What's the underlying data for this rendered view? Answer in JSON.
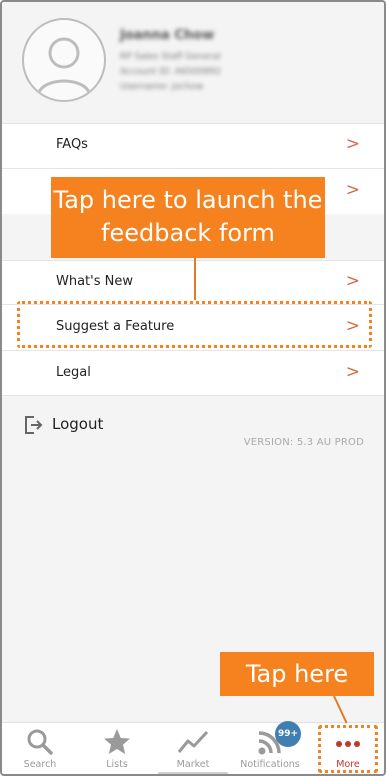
{
  "profile": {
    "name": "Joanna Chow",
    "line1": "RP Sales Staff General",
    "line2": "Account ID: A6500892",
    "line3": "Username: jochow"
  },
  "menu": {
    "faqs": "FAQs",
    "whats_new": "What's New",
    "suggest": "Suggest a Feature",
    "legal": "Legal",
    "chevron": ">"
  },
  "logout": {
    "label": "Logout"
  },
  "version": "VERSION: 5.3 AU PROD",
  "callouts": {
    "feedback": "Tap here to launch the feedback form",
    "tap_here": "Tap here"
  },
  "nav": {
    "search": "Search",
    "lists": "Lists",
    "market": "Market",
    "notifications": "Notifications",
    "notifications_badge": "99+",
    "more": "More",
    "active": "More"
  },
  "colors": {
    "accent_orange": "#f5821f",
    "chevron": "#d46a4a",
    "active_nav": "#c0392b",
    "badge": "#3f7fb2"
  }
}
